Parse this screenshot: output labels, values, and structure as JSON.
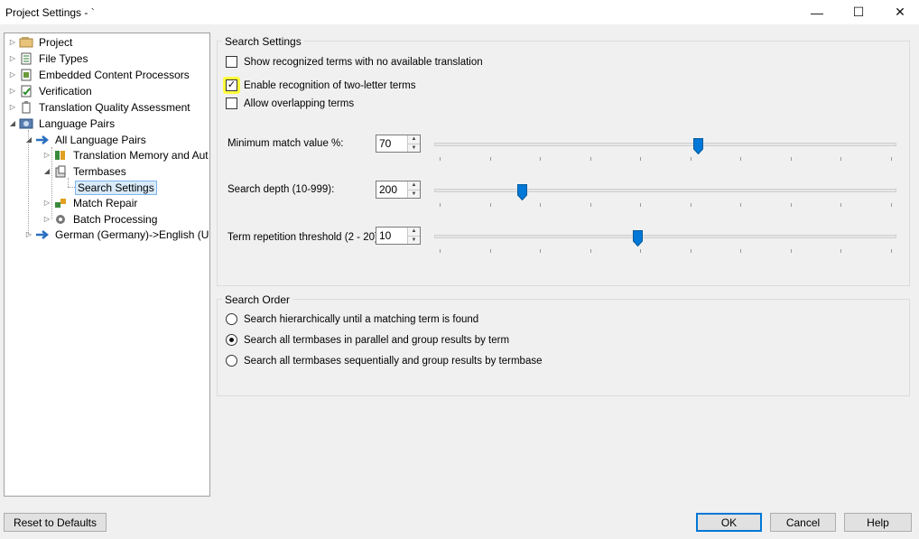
{
  "window": {
    "title": "Project Settings - `",
    "minimize_glyph": "—",
    "maximize_glyph": "☐",
    "close_glyph": "✕"
  },
  "tree": {
    "items": [
      {
        "label": "Project",
        "icon": "project-icon"
      },
      {
        "label": "File Types",
        "icon": "file-types-icon"
      },
      {
        "label": "Embedded Content Processors",
        "icon": "embedded-content-icon"
      },
      {
        "label": "Verification",
        "icon": "verification-icon"
      },
      {
        "label": "Translation Quality Assessment",
        "icon": "tqa-icon"
      },
      {
        "label": "Language Pairs",
        "icon": "language-pairs-icon"
      },
      {
        "label": "All Language Pairs",
        "icon": "arrow-right-icon"
      },
      {
        "label": "Translation Memory and Aut",
        "icon": "translation-memory-icon"
      },
      {
        "label": "Termbases",
        "icon": "termbases-icon"
      },
      {
        "label": "Search Settings",
        "icon": ""
      },
      {
        "label": "Match Repair",
        "icon": "match-repair-icon"
      },
      {
        "label": "Batch Processing",
        "icon": "gear-icon"
      },
      {
        "label": "German (Germany)->English (U",
        "icon": "arrow-right-icon"
      }
    ]
  },
  "search_settings": {
    "group_title": "Search Settings",
    "checkboxes": [
      {
        "label": "Show recognized terms with no available translation",
        "checked": false
      },
      {
        "label": "Enable recognition of two-letter terms",
        "checked": true
      },
      {
        "label": "Allow overlapping terms",
        "checked": false
      }
    ],
    "check_glyph": "✓",
    "min_match": {
      "label": "Minimum match value %:",
      "value": "70",
      "slider_fraction": 0.57
    },
    "search_depth": {
      "label": "Search depth (10-999):",
      "value": "200",
      "slider_fraction": 0.19
    },
    "term_repetition": {
      "label": "Term repetition threshold (2 - 20):",
      "value": "10",
      "slider_fraction": 0.44
    }
  },
  "search_order": {
    "group_title": "Search Order",
    "options": [
      {
        "label": "Search hierarchically until a matching term is found",
        "selected": false
      },
      {
        "label": "Search all termbases in parallel and group results by term",
        "selected": true
      },
      {
        "label": "Search all termbases sequentially and group results by termbase",
        "selected": false
      }
    ]
  },
  "buttons": {
    "reset": "Reset to Defaults",
    "ok": "OK",
    "cancel": "Cancel",
    "help": "Help"
  },
  "colors": {
    "accent": "#0078d7",
    "highlight": "#ffff3c",
    "selection": "#d9ebf9"
  }
}
